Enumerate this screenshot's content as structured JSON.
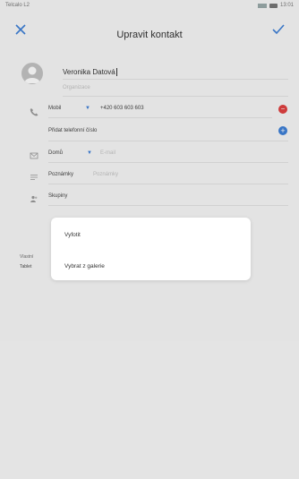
{
  "status_bar": {
    "carrier": "Telcalo L2",
    "time": "13:01"
  },
  "header": {
    "title": "Upravit kontakt"
  },
  "contact": {
    "name": "Veronika Datová",
    "organization_placeholder": "Organizace"
  },
  "phone": {
    "type": "Mobil",
    "number": "+420 603 603 603",
    "add_label": "Přidat telefonní číslo"
  },
  "email": {
    "type": "Domů",
    "placeholder": "E-mail"
  },
  "notes": {
    "label": "Poznámky",
    "placeholder": "Poznámky"
  },
  "groups": {
    "label": "Skupiny"
  },
  "background_partial": {
    "line1": "Vlastní",
    "line2": "Tablet"
  },
  "dialog": {
    "items": [
      "Vyfotit",
      "Vybrat z galerie"
    ]
  },
  "colors": {
    "accent": "#3d7fd7",
    "remove": "#e04040"
  }
}
